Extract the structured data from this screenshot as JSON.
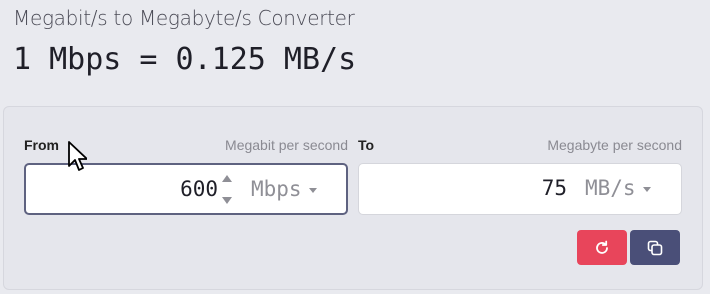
{
  "header": {
    "title": "Megabit/s to Megabyte/s Converter",
    "result": "1 Mbps = 0.125 MB/s"
  },
  "from": {
    "label": "From",
    "unit_caption": "Megabit per second",
    "value": "600",
    "unit": "Mbps"
  },
  "to": {
    "label": "To",
    "unit_caption": "Megabyte per second",
    "value": "75",
    "unit": "MB/s"
  },
  "buttons": {
    "reset_icon": "refresh-icon",
    "copy_icon": "copy-icon"
  },
  "colors": {
    "reset": "#e8455b",
    "copy": "#4a4f78",
    "active_border": "#5e6280"
  }
}
